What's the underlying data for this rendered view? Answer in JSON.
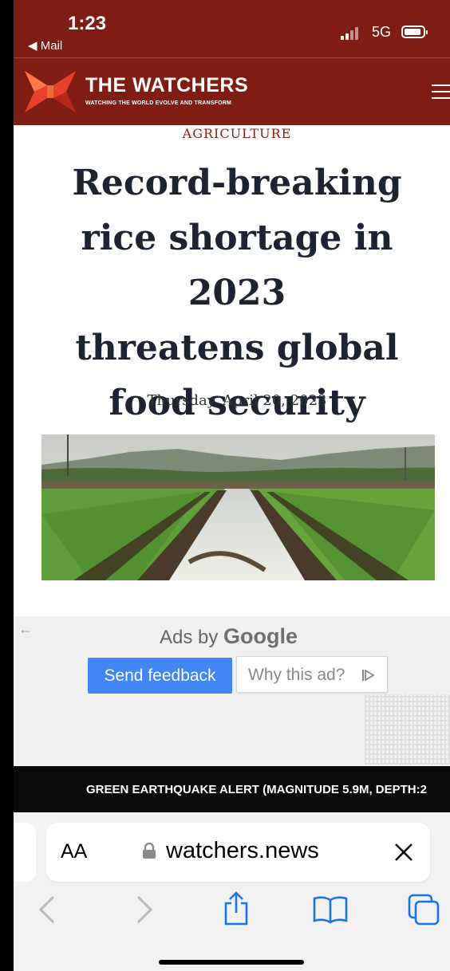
{
  "status": {
    "time": "1:23",
    "back_app": "◀ Mail",
    "network": "5G"
  },
  "site": {
    "brand": "THE WATCHERS",
    "tagline": "WATCHING THE WORLD EVOLVE AND TRANSFORM",
    "brand_color": "#7f1d14",
    "logo_color": "#e8402a"
  },
  "article": {
    "category": "AGRICULTURE",
    "headline_lines": [
      "Record-breaking",
      "rice shortage in 2023",
      "threatens global",
      "food security"
    ],
    "date": "Thursday, April 20, 2023"
  },
  "ad": {
    "ads_by": "Ads by",
    "google": "Google",
    "send_feedback": "Send feedback",
    "why_this_ad": "Why this ad?",
    "back_arrow": "←"
  },
  "ticker": {
    "text": "GREEN EARTHQUAKE ALERT (MAGNITUDE 5.9M, DEPTH:2"
  },
  "browser": {
    "aa_label": "AA",
    "url": "watchers.news"
  },
  "icons": {
    "back": "chevron-left-icon",
    "forward": "chevron-right-icon",
    "share": "share-icon",
    "bookmarks": "book-icon",
    "tabs": "tabs-icon",
    "close": "close-icon",
    "lock": "lock-icon"
  }
}
